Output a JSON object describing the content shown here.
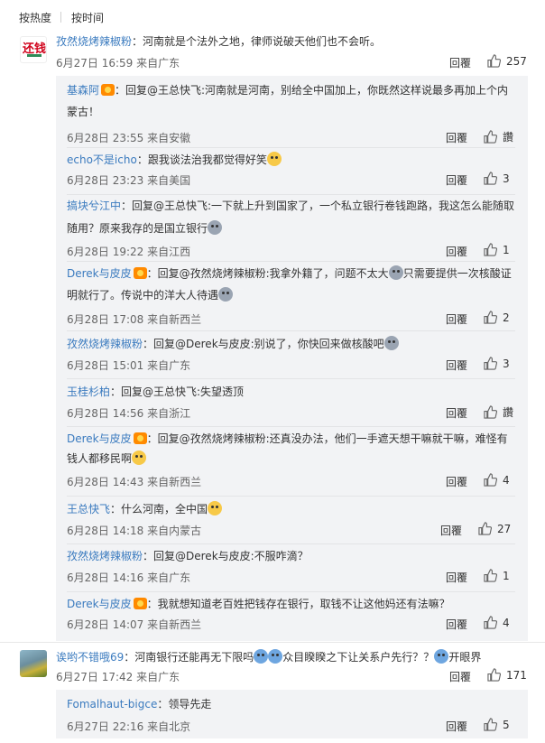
{
  "sort": {
    "hot": "按热度",
    "time": "按时间"
  },
  "comments": [
    {
      "user": "孜然烧烤辣椒粉",
      "text": "：河南就是个法外之地，律师说破天他们也不会听。",
      "date": "6月27日 16:59",
      "location": "来自广东",
      "reply_label": "回覆",
      "likes": "257",
      "avatar_label": "还钱",
      "replies": [
        {
          "user": "基森阿",
          "badge": true,
          "line1": "：回复@王总快飞:河南就是河南，别给全中国加上，你既然这样说最多再加上个内",
          "line2": "蒙古！",
          "date": "6月28日 23:55",
          "location": "来自安徽",
          "reply_label": "回覆",
          "likes": "讚"
        },
        {
          "user": "echo不是icho",
          "badge": false,
          "line1": "：跟我谈法治我都觉得好笑",
          "emoji": "yellow",
          "date": "6月28日 23:23",
          "location": "来自美国",
          "reply_label": "回覆",
          "likes": "3"
        },
        {
          "user": "搞块兮江中",
          "badge": false,
          "line1": "：回复@王总快飞:一下就上升到国家了，一个私立银行卷钱跑路，我这怎么能随取",
          "line2": "随用？原来我存的是国立银行",
          "emoji2": "gray",
          "date": "6月28日 19:22",
          "location": "来自江西",
          "reply_label": "回覆",
          "likes": "1"
        },
        {
          "user": "Derek与皮皮",
          "badge": true,
          "line1": "：回复@孜然烧烤辣椒粉:我拿外籍了，问题不太大",
          "line1b": "只需要提供一次核酸证",
          "line2": "明就行了。传说中的洋大人待遇",
          "emoji2": "gray",
          "date": "6月28日 17:08",
          "location": "来自新西兰",
          "reply_label": "回覆",
          "likes": "2"
        },
        {
          "user": "孜然烧烤辣椒粉",
          "badge": false,
          "line1": "：回复@Derek与皮皮:别说了，你快回来做核酸吧",
          "emoji": "gray",
          "date": "6月28日 15:01",
          "location": "来自广东",
          "reply_label": "回覆",
          "likes": "3"
        },
        {
          "user": "玉桂杉柏",
          "badge": false,
          "line1": "：回复@王总快飞:失望透顶",
          "date": "6月28日 14:56",
          "location": "来自浙江",
          "reply_label": "回覆",
          "likes": "讚"
        },
        {
          "user": "Derek与皮皮",
          "badge": true,
          "line1": "：回复@孜然烧烤辣椒粉:还真没办法，他们一手遮天想干嘛就干嘛，难怪有",
          "line2": "钱人都移民啊",
          "emoji2": "yellow",
          "date": "6月28日 14:43",
          "location": "来自新西兰",
          "reply_label": "回覆",
          "likes": "4"
        },
        {
          "user": "王总快飞",
          "badge": false,
          "line1": "：什么河南，全中国",
          "emoji": "yellow",
          "date": "6月28日 14:18",
          "location": "来自内蒙古",
          "reply_label": "回覆",
          "likes": "27"
        },
        {
          "user": "孜然烧烤辣椒粉",
          "badge": false,
          "line1": "：回复@Derek与皮皮:不服咋滴？",
          "date": "6月28日 14:16",
          "location": "来自广东",
          "reply_label": "回覆",
          "likes": "1"
        },
        {
          "user": "Derek与皮皮",
          "badge": true,
          "line1": "：我就想知道老百姓把钱存在银行，取钱不让这他妈还有法嘛？",
          "date": "6月28日 14:07",
          "location": "来自新西兰",
          "reply_label": "回覆",
          "likes": "4"
        }
      ]
    },
    {
      "user": "诶哟不错哦69",
      "text_a": "：河南银行还能再无下限吗",
      "text_b": "众目睽睽之下让关系户先行？？",
      "text_c": "开眼界",
      "date": "6月27日 17:42",
      "location": "来自广东",
      "reply_label": "回覆",
      "likes": "171",
      "replies": [
        {
          "user": "Fomalhaut-bigce",
          "badge": false,
          "line1": "：领导先走",
          "date": "6月27日 22:16",
          "location": "来自北京",
          "reply_label": "回覆",
          "likes": "5"
        }
      ]
    }
  ]
}
